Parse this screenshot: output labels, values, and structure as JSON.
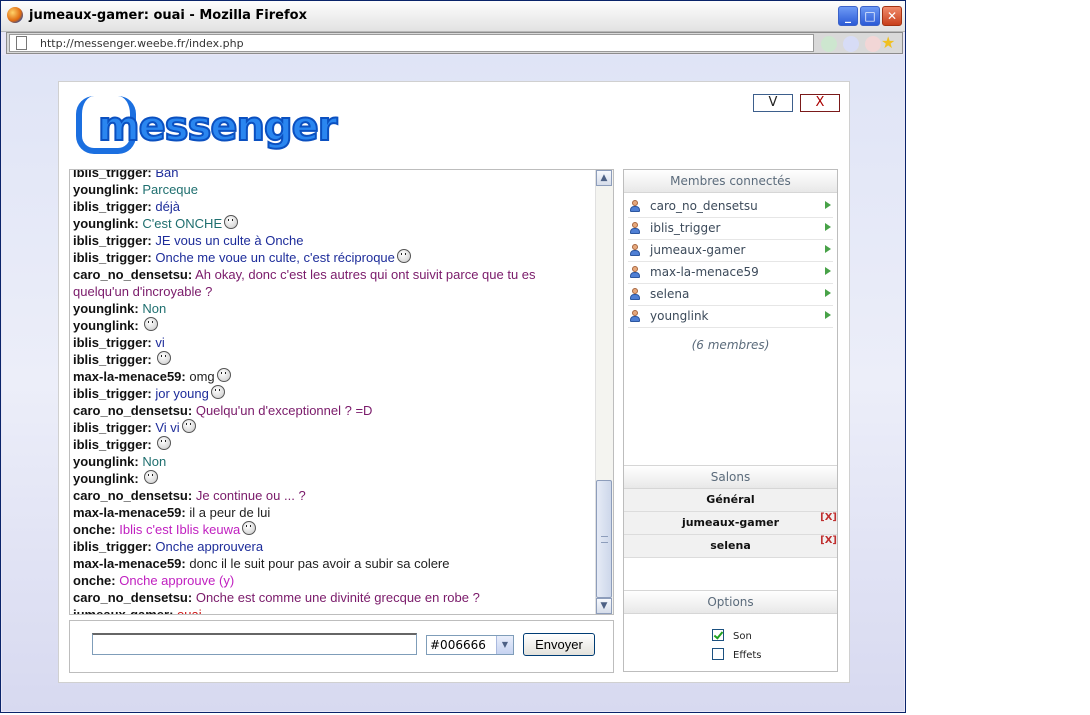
{
  "window": {
    "title": "jumeaux-gamer: ouai - Mozilla Firefox",
    "url": "http://messenger.weebe.fr/index.php"
  },
  "app": {
    "logo": "messenger",
    "btn_v": "V",
    "btn_x": "X"
  },
  "messages": [
    {
      "nick": "iblis_trigger:",
      "text": "Bah",
      "color": "#1d2c9a"
    },
    {
      "nick": "younglink:",
      "text": "Parceque",
      "color": "#1f6f6f"
    },
    {
      "nick": "iblis_trigger:",
      "text": "déjà",
      "color": "#1d2c9a"
    },
    {
      "nick": "younglink:",
      "text": "C'est ONCHE",
      "color": "#1f6f6f",
      "smiley": true
    },
    {
      "nick": "iblis_trigger:",
      "text": "JE vous un culte à Onche",
      "color": "#1d2c9a"
    },
    {
      "nick": "iblis_trigger:",
      "text": "Onche me voue un culte, c'est réciproque",
      "color": "#1d2c9a",
      "smiley": true
    },
    {
      "nick": "caro_no_densetsu:",
      "text": "Ah okay, donc c'est les autres qui ont suivit parce que tu es quelqu'un d'incroyable ?",
      "color": "#7a1a6a",
      "wrap": true
    },
    {
      "nick": "younglink:",
      "text": "Non",
      "color": "#1f6f6f"
    },
    {
      "nick": "younglink:",
      "text": "",
      "color": "#1f6f6f",
      "smiley": true
    },
    {
      "nick": "iblis_trigger:",
      "text": "vi",
      "color": "#1d2c9a"
    },
    {
      "nick": "iblis_trigger:",
      "text": "",
      "color": "#1d2c9a",
      "smiley": true
    },
    {
      "nick": "max-la-menace59:",
      "text": "omg",
      "color": "#222222",
      "smiley": true
    },
    {
      "nick": "iblis_trigger:",
      "text": "jor young",
      "color": "#1d2c9a",
      "smiley": true
    },
    {
      "nick": "caro_no_densetsu:",
      "text": "Quelqu'un d'exceptionnel ? =D",
      "color": "#7a1a6a"
    },
    {
      "nick": "iblis_trigger:",
      "text": "Vi vi",
      "color": "#1d2c9a",
      "smiley": true
    },
    {
      "nick": "iblis_trigger:",
      "text": "",
      "color": "#1d2c9a",
      "smiley": true
    },
    {
      "nick": "younglink:",
      "text": "Non",
      "color": "#1f6f6f"
    },
    {
      "nick": "younglink:",
      "text": "",
      "color": "#1f6f6f",
      "smiley": true
    },
    {
      "nick": "caro_no_densetsu:",
      "text": "Je continue ou ... ?",
      "color": "#7a1a6a"
    },
    {
      "nick": "max-la-menace59:",
      "text": "il a peur de lui",
      "color": "#222222"
    },
    {
      "nick": "onche:",
      "text": "Iblis c'est Iblis keuwa",
      "color": "#c020c0",
      "smiley": true
    },
    {
      "nick": "iblis_trigger:",
      "text": "Onche approuvera",
      "color": "#1d2c9a"
    },
    {
      "nick": "max-la-menace59:",
      "text": "donc il le suit pour pas avoir a subir sa colere",
      "color": "#222222"
    },
    {
      "nick": "onche:",
      "text": "Onche approuve (y)",
      "color": "#c020c0"
    },
    {
      "nick": "caro_no_densetsu:",
      "text": "Onche est comme une divinité grecque en robe ?",
      "color": "#7a1a6a"
    },
    {
      "nick": "jumeaux-gamer:",
      "text": "ouai",
      "color": "#cc1111"
    }
  ],
  "input": {
    "value": "",
    "color_value": "#006666",
    "send_label": "Envoyer"
  },
  "members": {
    "title": "Membres connectés",
    "list": [
      "caro_no_densetsu",
      "iblis_trigger",
      "jumeaux-gamer",
      "max-la-menace59",
      "selena",
      "younglink"
    ],
    "count_label": "(6 membres)"
  },
  "salons": {
    "title": "Salons",
    "rooms": [
      {
        "name": "Général",
        "closable": false
      },
      {
        "name": "jumeaux-gamer",
        "closable": true
      },
      {
        "name": "selena",
        "closable": true
      }
    ],
    "close_label": "[X]"
  },
  "options": {
    "title": "Options",
    "items": [
      {
        "label": "Son",
        "checked": true
      },
      {
        "label": "Effets",
        "checked": false
      }
    ]
  }
}
